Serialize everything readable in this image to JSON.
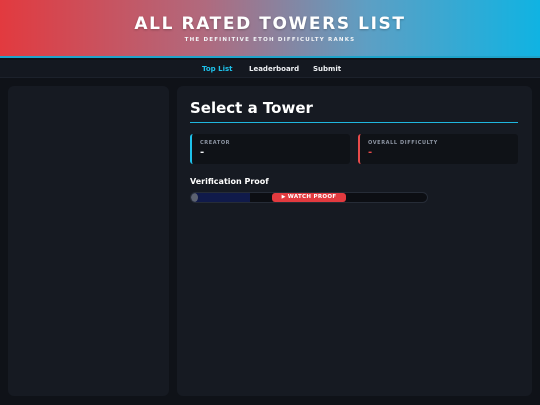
{
  "header": {
    "title": "ALL RATED TOWERS LIST",
    "subtitle": "THE DEFINITIVE ETOH DIFFICULTY RANKS"
  },
  "nav": {
    "items": [
      {
        "label": "Top List",
        "active": true
      },
      {
        "label": "Leaderboard",
        "active": false
      },
      {
        "label": "Submit",
        "active": false
      }
    ]
  },
  "tower": {
    "title": "Select a Tower",
    "creator": {
      "label": "CREATOR",
      "value": "-"
    },
    "difficulty": {
      "label": "OVERALL DIFFICULTY",
      "value": "-"
    }
  },
  "proof": {
    "label": "Verification Proof",
    "watch_label": "WATCH PROOF",
    "play_icon": "play-icon",
    "progress": 0.25
  },
  "colors": {
    "accent_cyan": "#1ec1ea",
    "accent_red": "#e23a3f",
    "background": "#0f1218",
    "panel": "#161a22"
  }
}
